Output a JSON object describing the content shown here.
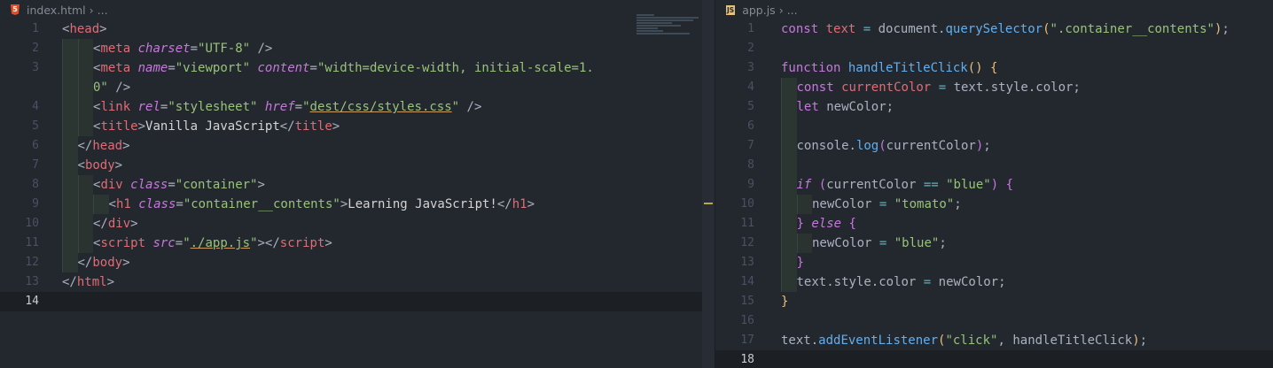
{
  "left": {
    "file_icon": "html5-icon",
    "breadcrumb": [
      "index.html",
      "..."
    ],
    "lines": [
      {
        "n": "1",
        "html": "<span class='t-br'>&lt;</span><span class='t-tag'>head</span><span class='t-br'>&gt;</span>",
        "indent": 0
      },
      {
        "n": "2",
        "html": "<span class='t-br'>&lt;</span><span class='t-tag'>meta</span> <span class='t-attr'>charset</span><span class='t-br'>=</span><span class='t-str'>\"UTF-8\"</span> <span class='t-br'>/&gt;</span>",
        "indent": 2
      },
      {
        "n": "3",
        "html": "<span class='t-br'>&lt;</span><span class='t-tag'>meta</span> <span class='t-attr'>name</span><span class='t-br'>=</span><span class='t-str'>\"viewport\"</span> <span class='t-attr'>content</span><span class='t-br'>=</span><span class='t-str'>\"width=device-width, initial-scale=1.</span>",
        "indent": 2
      },
      {
        "n": "",
        "html": "<span class='t-str'>0\"</span> <span class='t-br'>/&gt;</span>",
        "indent": 2
      },
      {
        "n": "4",
        "html": "<span class='t-br'>&lt;</span><span class='t-tag'>link</span> <span class='t-attr'>rel</span><span class='t-br'>=</span><span class='t-str'>\"stylesheet\"</span> <span class='t-attr'>href</span><span class='t-br'>=</span><span class='t-str'>\"</span><span class='t-link'>dest/css/styles.css</span><span class='t-str'>\"</span> <span class='t-br'>/&gt;</span>",
        "indent": 2
      },
      {
        "n": "5",
        "html": "<span class='t-br'>&lt;</span><span class='t-tag'>title</span><span class='t-br'>&gt;</span><span class='t-txt'>Vanilla JavaScript</span><span class='t-br'>&lt;/</span><span class='t-tag'>title</span><span class='t-br'>&gt;</span>",
        "indent": 2
      },
      {
        "n": "6",
        "html": "<span class='t-br'>&lt;/</span><span class='t-tag'>head</span><span class='t-br'>&gt;</span>",
        "indent": 1
      },
      {
        "n": "7",
        "html": "<span class='t-br'>&lt;</span><span class='t-tag'>body</span><span class='t-br'>&gt;</span>",
        "indent": 1
      },
      {
        "n": "8",
        "html": "<span class='t-br'>&lt;</span><span class='t-tag'>div</span> <span class='t-attr'>class</span><span class='t-br'>=</span><span class='t-str'>\"container\"</span><span class='t-br'>&gt;</span>",
        "indent": 2
      },
      {
        "n": "9",
        "html": "<span class='t-br'>&lt;</span><span class='t-tag'>h1</span> <span class='t-attr'>class</span><span class='t-br'>=</span><span class='t-str'>\"container__contents\"</span><span class='t-br'>&gt;</span><span class='t-txt'>Learning JavaScript!</span><span class='t-br'>&lt;/</span><span class='t-tag'>h1</span><span class='t-br'>&gt;</span>",
        "indent": 3
      },
      {
        "n": "10",
        "html": "<span class='t-br'>&lt;/</span><span class='t-tag'>div</span><span class='t-br'>&gt;</span>",
        "indent": 2
      },
      {
        "n": "11",
        "html": "<span class='t-br'>&lt;</span><span class='t-tag'>script</span> <span class='t-attr'>src</span><span class='t-br'>=</span><span class='t-str'>\"</span><span class='t-link'>./app.js</span><span class='t-str'>\"</span><span class='t-br'>&gt;&lt;/</span><span class='t-tag'>script</span><span class='t-br'>&gt;</span>",
        "indent": 2
      },
      {
        "n": "12",
        "html": "<span class='t-br'>&lt;/</span><span class='t-tag'>body</span><span class='t-br'>&gt;</span>",
        "indent": 1
      },
      {
        "n": "13",
        "html": "<span class='t-br'>&lt;/</span><span class='t-tag'>html</span><span class='t-br'>&gt;</span>",
        "indent": 0
      },
      {
        "n": "14",
        "html": "",
        "indent": 0,
        "current": true
      }
    ]
  },
  "right": {
    "file_icon": "js-file-icon",
    "icon_label": "JS",
    "breadcrumb": [
      "app.js",
      "..."
    ],
    "lines": [
      {
        "n": "1",
        "html": "<span class='k'>const</span> <span class='v'>text</span> <span class='op'>=</span> <span class='p'>document.</span><span class='f'>querySelector</span><span class='par'>(</span><span class='s'>\".container__contents\"</span><span class='par'>)</span><span class='p'>;</span>",
        "indent": 0
      },
      {
        "n": "2",
        "html": "",
        "indent": 0
      },
      {
        "n": "3",
        "html": "<span class='k'>function</span> <span class='f'>handleTitleClick</span><span class='par'>()</span> <span class='par'>{</span>",
        "indent": 0
      },
      {
        "n": "4",
        "html": "<span class='k'>const</span> <span class='v'>currentColor</span> <span class='op'>=</span> <span class='p'>text.style.color;</span>",
        "indent": 1
      },
      {
        "n": "5",
        "html": "<span class='k'>let</span> <span class='p'>newColor;</span>",
        "indent": 1
      },
      {
        "n": "6",
        "html": "",
        "indent": 1
      },
      {
        "n": "7",
        "html": "<span class='p'>console.</span><span class='f'>log</span><span class='par2'>(</span><span class='p'>currentColor</span><span class='par2'>)</span><span class='p'>;</span>",
        "indent": 1
      },
      {
        "n": "8",
        "html": "",
        "indent": 1
      },
      {
        "n": "9",
        "html": "<span class='ki'>if</span> <span class='par2'>(</span><span class='p'>currentColor</span> <span class='op'>==</span> <span class='s'>\"blue\"</span><span class='par2'>)</span> <span class='par2'>{</span>",
        "indent": 1
      },
      {
        "n": "10",
        "html": "<span class='p'>newColor</span> <span class='op'>=</span> <span class='s'>\"tomato\"</span><span class='p'>;</span>",
        "indent": 2
      },
      {
        "n": "11",
        "html": "<span class='par2'>}</span> <span class='ki'>else</span> <span class='par2'>{</span>",
        "indent": 1
      },
      {
        "n": "12",
        "html": "<span class='p'>newColor</span> <span class='op'>=</span> <span class='s'>\"blue\"</span><span class='p'>;</span>",
        "indent": 2
      },
      {
        "n": "13",
        "html": "<span class='par2'>}</span>",
        "indent": 1
      },
      {
        "n": "14",
        "html": "<span class='p'>text.style.color</span> <span class='op'>=</span> <span class='p'>newColor;</span>",
        "indent": 1
      },
      {
        "n": "15",
        "html": "<span class='par'>}</span>",
        "indent": 0
      },
      {
        "n": "16",
        "html": "",
        "indent": 0
      },
      {
        "n": "17",
        "html": "<span class='p'>text.</span><span class='f'>addEventListener</span><span class='par'>(</span><span class='s'>\"click\"</span><span class='p'>,</span> <span class='p'>handleTitleClick</span><span class='par'>)</span><span class='p'>;</span>",
        "indent": 0
      },
      {
        "n": "18",
        "html": "",
        "indent": 0,
        "current": true
      }
    ]
  }
}
